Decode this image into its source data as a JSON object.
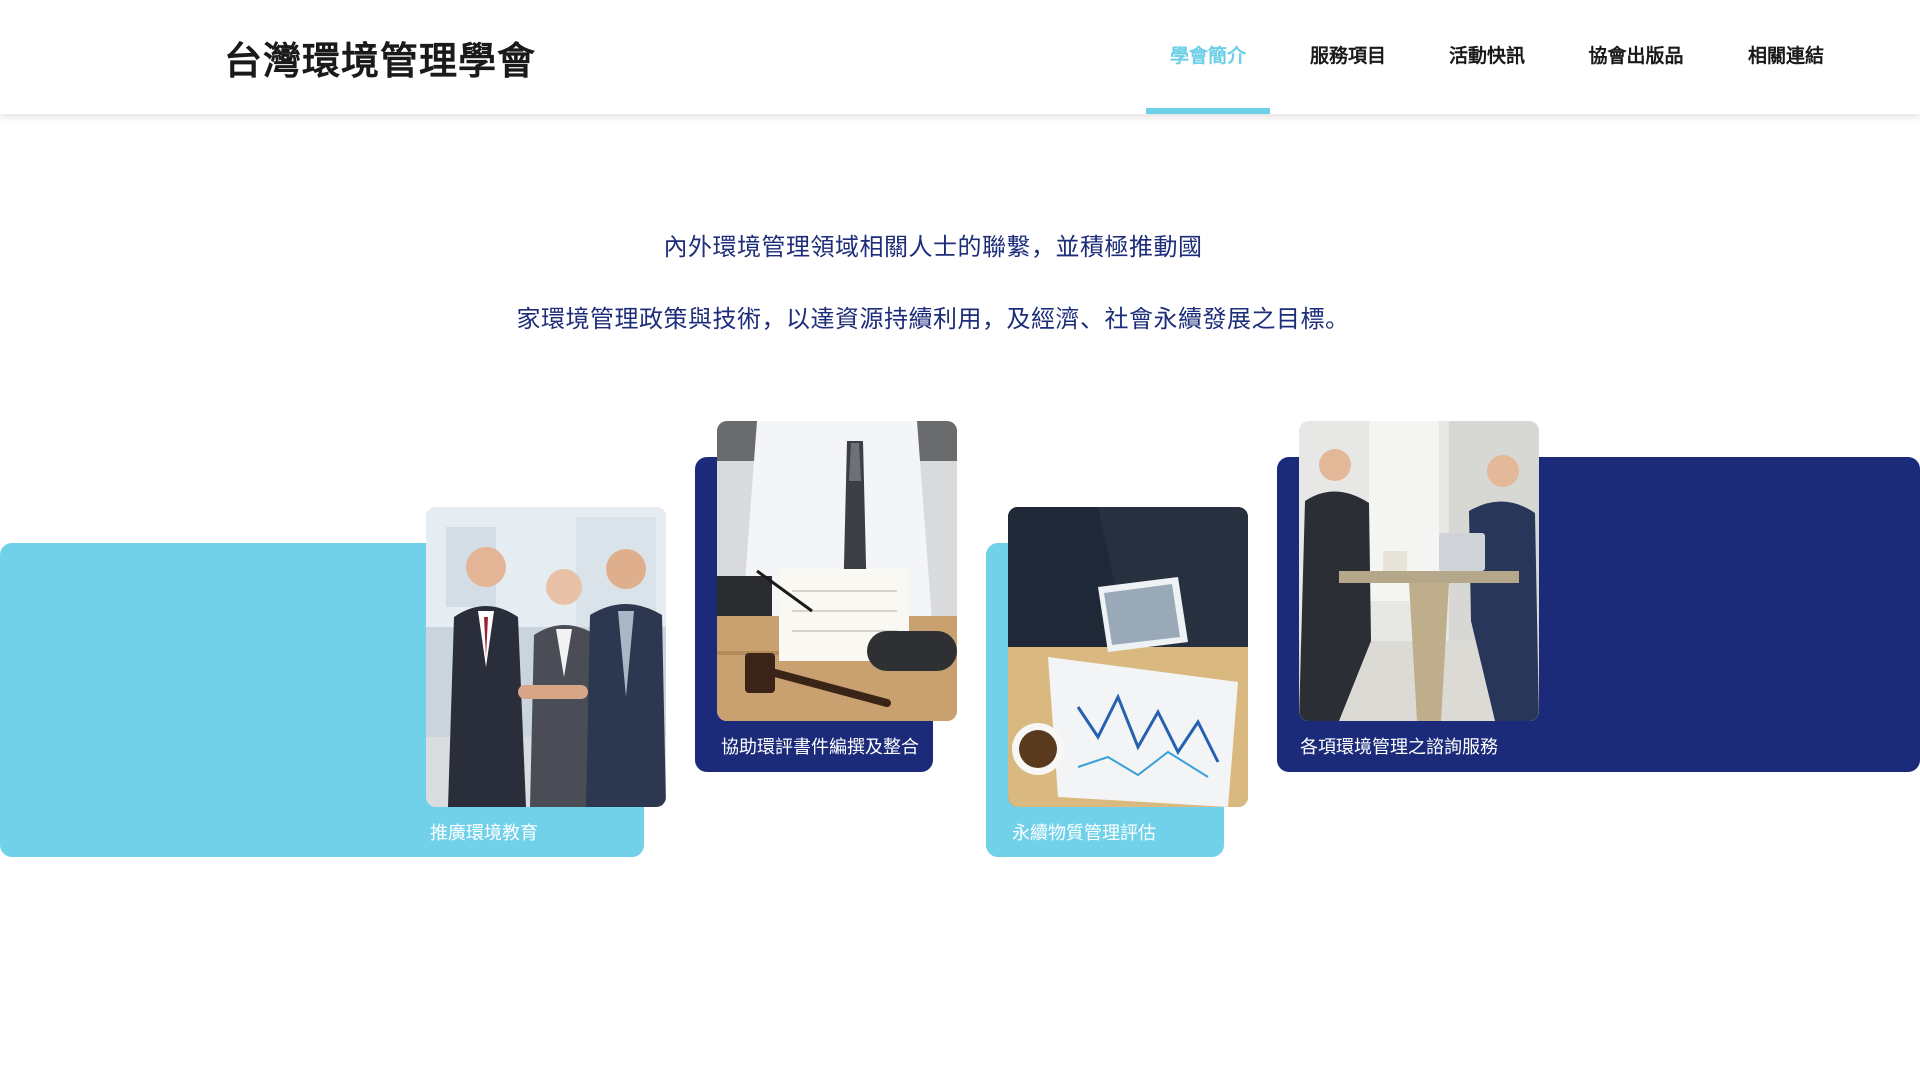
{
  "site": {
    "title": "台灣環境管理學會"
  },
  "nav": {
    "items": [
      {
        "label": "學會簡介",
        "active": true
      },
      {
        "label": "服務項目",
        "active": false
      },
      {
        "label": "活動快訊",
        "active": false
      },
      {
        "label": "協會出版品",
        "active": false
      },
      {
        "label": "相關連結",
        "active": false
      }
    ]
  },
  "intro": {
    "line1": "內外環境管理領域相關人士的聯繫，並積極推動國",
    "line2": "家環境管理政策與技術，以達資源持續利用，及經濟、社會永續發展之目標。"
  },
  "services": [
    {
      "label": "推廣環境教育",
      "photo": "handshake-photo"
    },
    {
      "label": "協助環評書件編撰及整合",
      "photo": "document-signing-photo"
    },
    {
      "label": "永續物質管理評估",
      "photo": "financial-charts-photo"
    },
    {
      "label": "各項環境管理之諮詢服務",
      "photo": "consultation-meeting-photo"
    }
  ],
  "colors": {
    "accent": "#6ecfe8",
    "navy": "#1b2b79",
    "text": "#1d2d7a"
  }
}
